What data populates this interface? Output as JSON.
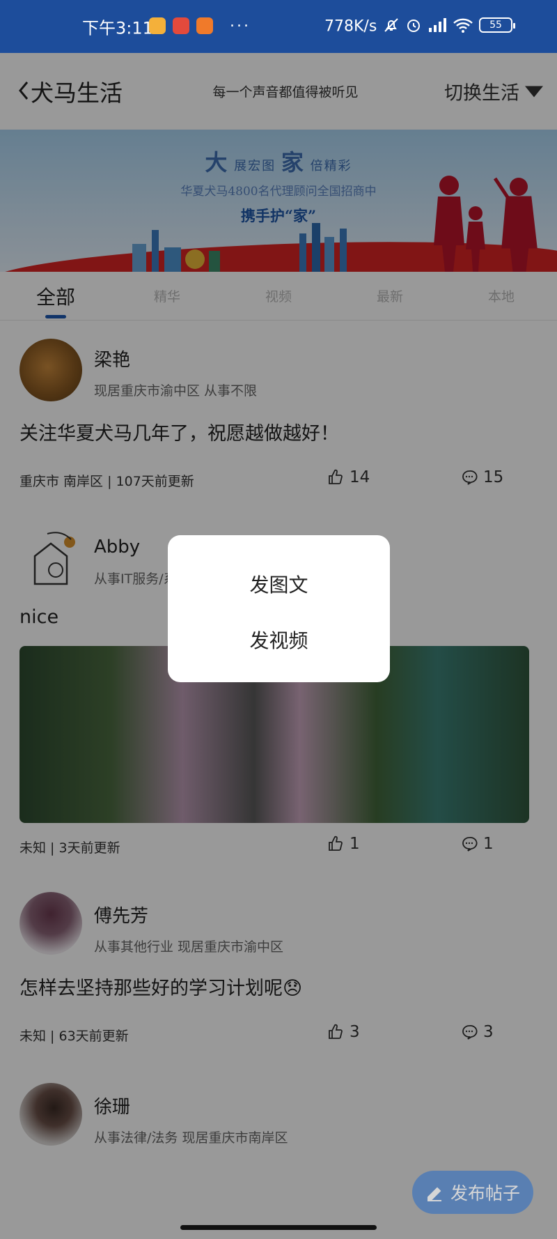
{
  "status_bar": {
    "time": "下午3:11",
    "dots": "···",
    "network_speed": "778K/s",
    "battery": "55"
  },
  "header": {
    "title": "犬马生活",
    "slogan": "每一个声音都值得被听见",
    "switch_label": "切换生活"
  },
  "banner": {
    "big1": "大",
    "small1": "展宏图",
    "big2": "家",
    "small2": "倍精彩",
    "line2": "华夏犬马4800名代理顾问全国招商中",
    "line3": "携手护“家”"
  },
  "tabs": [
    {
      "label": "全部",
      "active": true
    },
    {
      "label": "精华",
      "active": false
    },
    {
      "label": "视频",
      "active": false
    },
    {
      "label": "最新",
      "active": false
    },
    {
      "label": "本地",
      "active": false
    }
  ],
  "posts": [
    {
      "username": "梁艳",
      "meta": "现居重庆市渝中区 从事不限",
      "content": "关注华夏犬马几年了，祝愿越做越好！",
      "location_time": "重庆市 南岸区 | 107天前更新",
      "likes": "14",
      "comments": "15"
    },
    {
      "username": "Abby",
      "meta": "从事IT服务/系统集成",
      "content": "nice",
      "location_time": "未知 | 3天前更新",
      "likes": "1",
      "comments": "1"
    },
    {
      "username": "傅先芳",
      "meta": "从事其他行业 现居重庆市渝中区",
      "content": "怎样去坚持那些好的学习计划呢😞",
      "location_time": "未知 | 63天前更新",
      "likes": "3",
      "comments": "3"
    },
    {
      "username": "徐珊",
      "meta": "从事法律/法务 现居重庆市南岸区"
    }
  ],
  "popup": {
    "option1": "发图文",
    "option2": "发视频"
  },
  "publish_button": "发布帖子",
  "colors": {
    "status_bar": "#1d4d9b",
    "accent": "#1d57b0",
    "publish": "#2f6fc4"
  }
}
